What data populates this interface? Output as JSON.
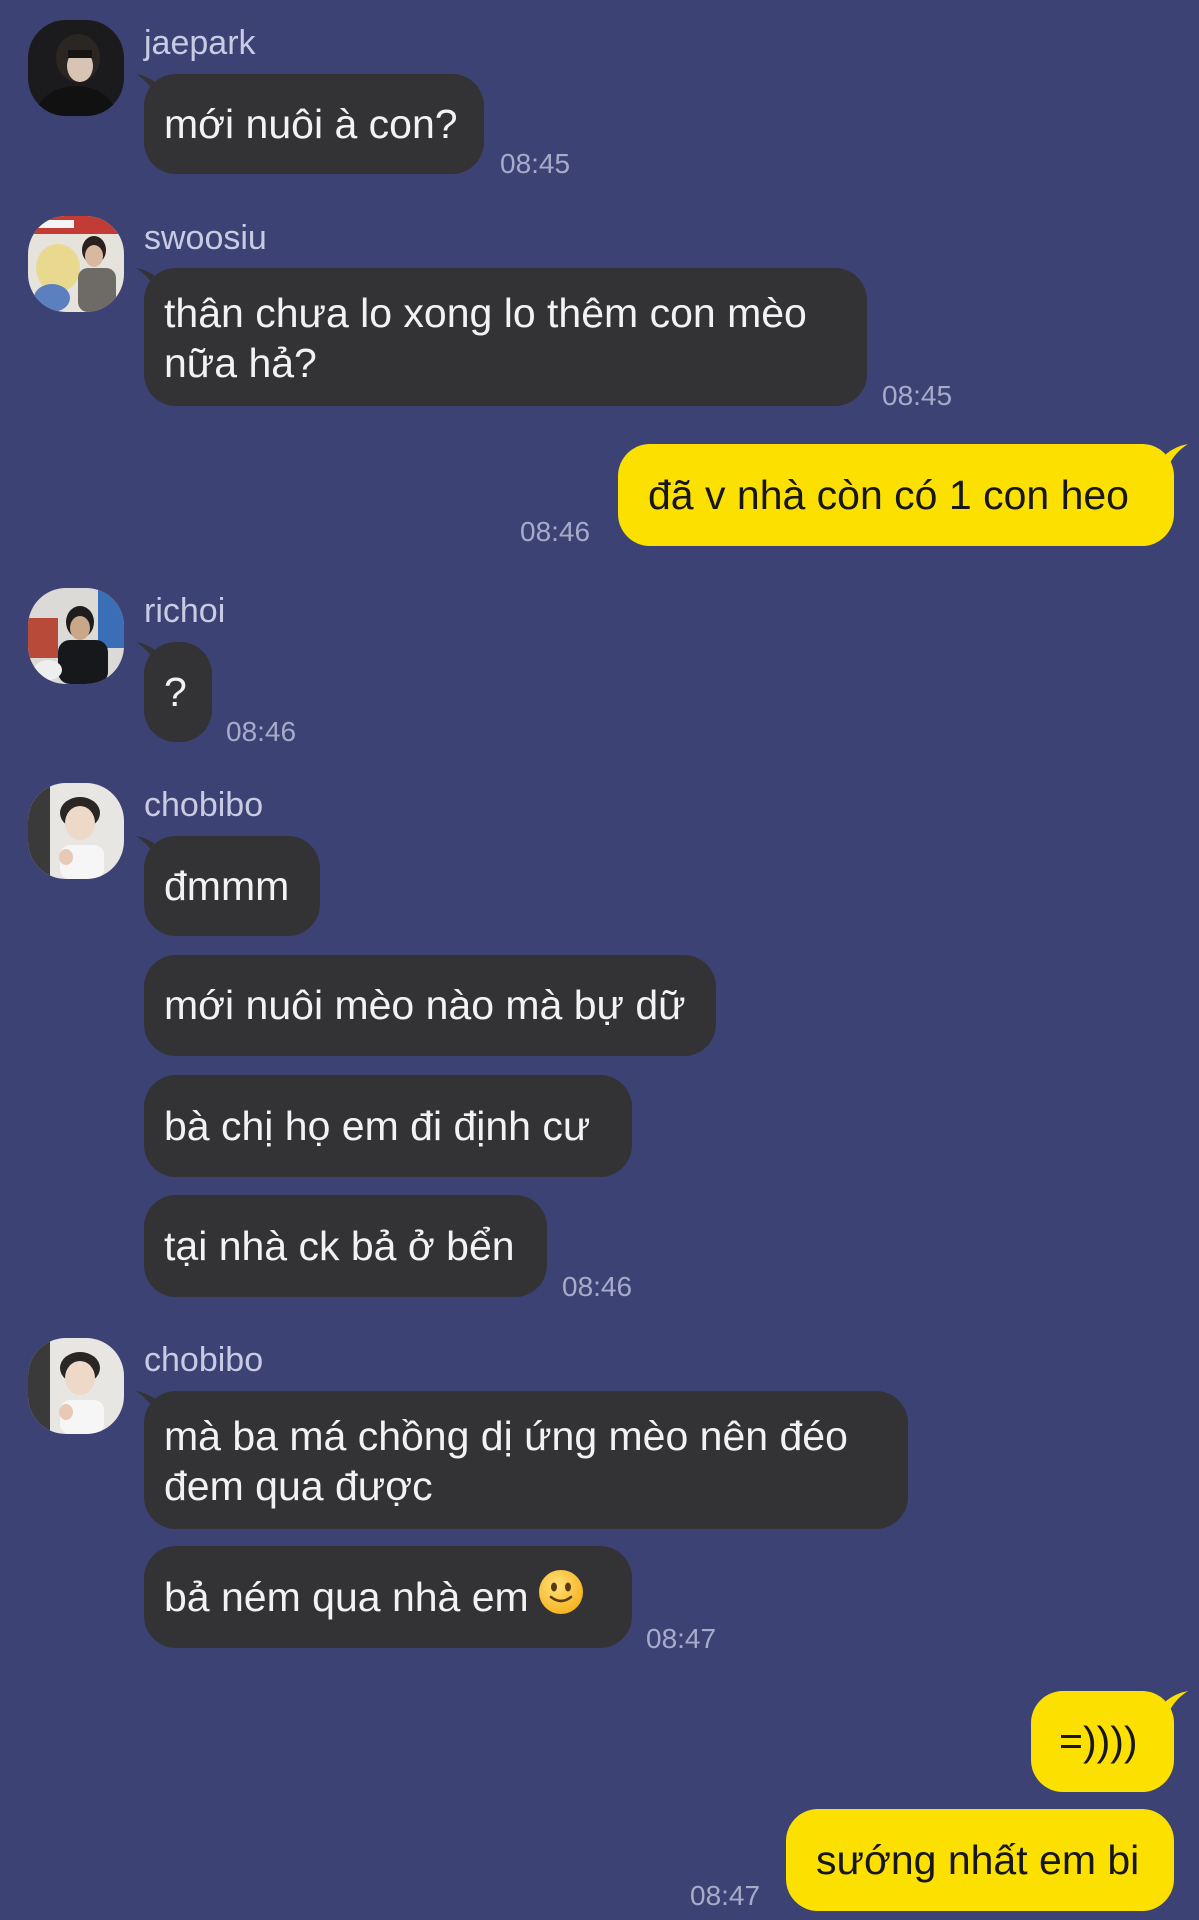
{
  "theme": {
    "background": "#3c4273",
    "incoming_bubble": "#333336",
    "outgoing_bubble": "#fbe000",
    "incoming_text": "#f2f2f2",
    "outgoing_text": "#17171a",
    "meta_text": "#a7abca"
  },
  "messages": [
    {
      "sender": "jaepark",
      "lines": [
        "mới nuôi à con?"
      ],
      "time": "08:45"
    },
    {
      "sender": "swoosiu",
      "lines": [
        "thân chưa lo xong lo thêm con mèo",
        "nữa hả?"
      ],
      "time": "08:45"
    },
    {
      "sender": "me",
      "lines": [
        "đã v nhà còn có 1 con heo"
      ],
      "time": "08:46"
    },
    {
      "sender": "richoi",
      "lines": [
        "?"
      ],
      "time": "08:46"
    },
    {
      "sender": "chobibo",
      "bubbles": [
        "đmmm",
        "mới nuôi mèo nào mà bự dữ",
        "bà chị họ em đi định cư",
        "tại nhà ck bả ở bển"
      ],
      "time": "08:46"
    },
    {
      "sender": "chobibo",
      "bubbles": [
        [
          "mà ba má chồng dị ứng mèo nên đéo",
          "đem qua được"
        ],
        "bả ném qua nhà em"
      ],
      "emoji": "slightly-smiling-face-icon",
      "time": "08:47"
    },
    {
      "sender": "me",
      "bubbles": [
        "=))))",
        "sướng nhất em bi"
      ],
      "time": "08:47"
    }
  ]
}
